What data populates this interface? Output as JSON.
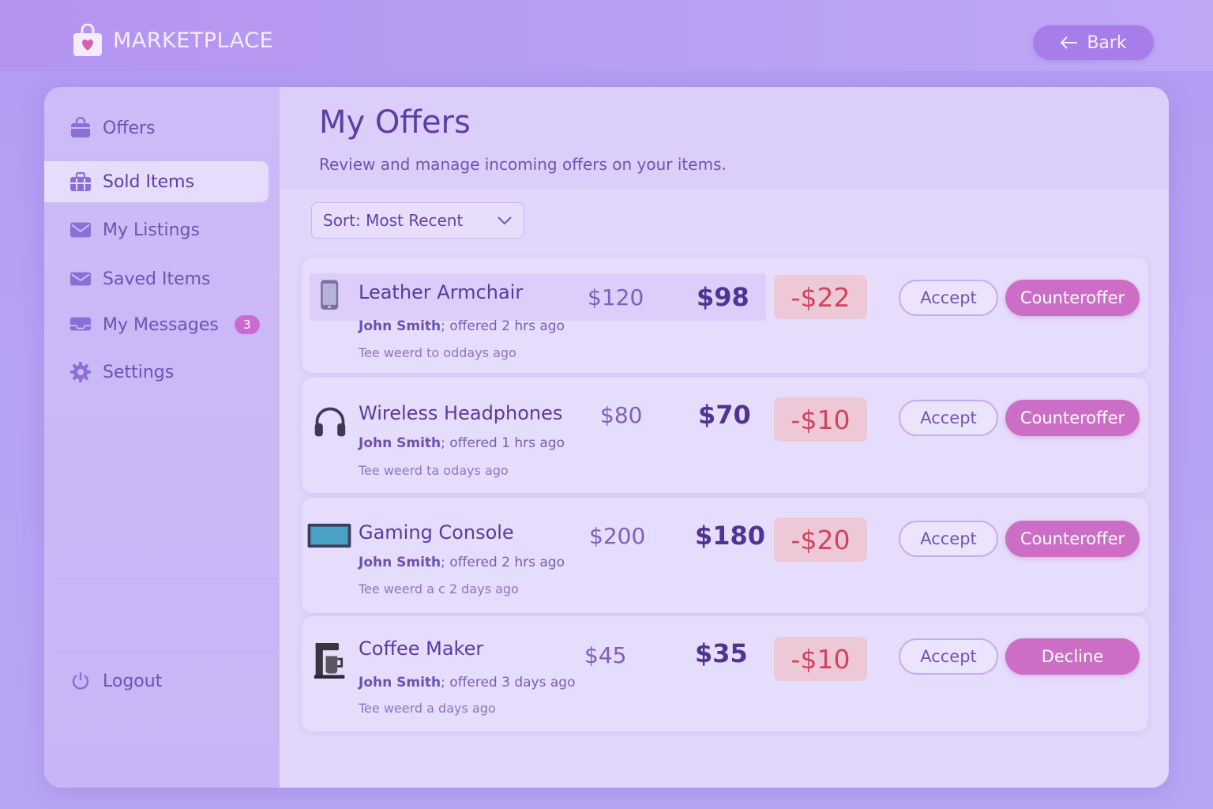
{
  "app": {
    "title": "MARKETPLACE",
    "back_label": "Bark"
  },
  "sidebar": {
    "items": [
      {
        "label": "Offers",
        "icon": "shopping-bag-icon"
      },
      {
        "label": "Sold Items",
        "icon": "briefcase-icon",
        "active": true
      },
      {
        "label": "My Listings",
        "icon": "envelope-icon"
      },
      {
        "label": "Saved Items",
        "icon": "envelope-icon"
      },
      {
        "label": "My Messages",
        "icon": "inbox-icon",
        "badge": "3"
      },
      {
        "label": "Settings",
        "icon": "gear-icon"
      }
    ],
    "logout_label": "Logout"
  },
  "main": {
    "title": "My Offers",
    "subtitle": "Review and manage incoming offers on your items.",
    "sort_label": "Sort: Most Recent"
  },
  "offers": [
    {
      "name": "Leather Armchair",
      "buyer": "John Smith",
      "offered": "; offered 2 hrs ago",
      "note": "Tee weerd to oddays ago",
      "original_price": "$120",
      "offer_price": "$98",
      "difference": "-$22",
      "accept_label": "Accept",
      "action_label": "Counteroffer",
      "thumb": "phone-icon"
    },
    {
      "name": "Wireless Headphones",
      "buyer": "John Smith",
      "offered": "; offered 1 hrs ago",
      "note": "Tee weerd ta odays ago",
      "original_price": "$80",
      "offer_price": "$70",
      "difference": "-$10",
      "accept_label": "Accept",
      "action_label": "Counteroffer",
      "thumb": "headphones-icon"
    },
    {
      "name": "Gaming Console",
      "buyer": "John Smith",
      "offered": "; offered 2 hrs ago",
      "note": "Tee weerd a c 2 days ago",
      "original_price": "$200",
      "offer_price": "$180",
      "difference": "-$20",
      "accept_label": "Accept",
      "action_label": "Counteroffer",
      "thumb": "monitor-icon"
    },
    {
      "name": "Coffee Maker",
      "buyer": "John Smith",
      "offered": "; offered 3 days ago",
      "note": "Tee weerd a days ago",
      "original_price": "$45",
      "offer_price": "$35",
      "difference": "-$10",
      "accept_label": "Accept",
      "action_label": "Decline",
      "thumb": "coffee-maker-icon"
    }
  ],
  "colors": {
    "accent": "#cc6ec6",
    "primary_text": "#563c9f",
    "difference_bg": "#edc8d6",
    "difference_text": "#d3435f"
  }
}
